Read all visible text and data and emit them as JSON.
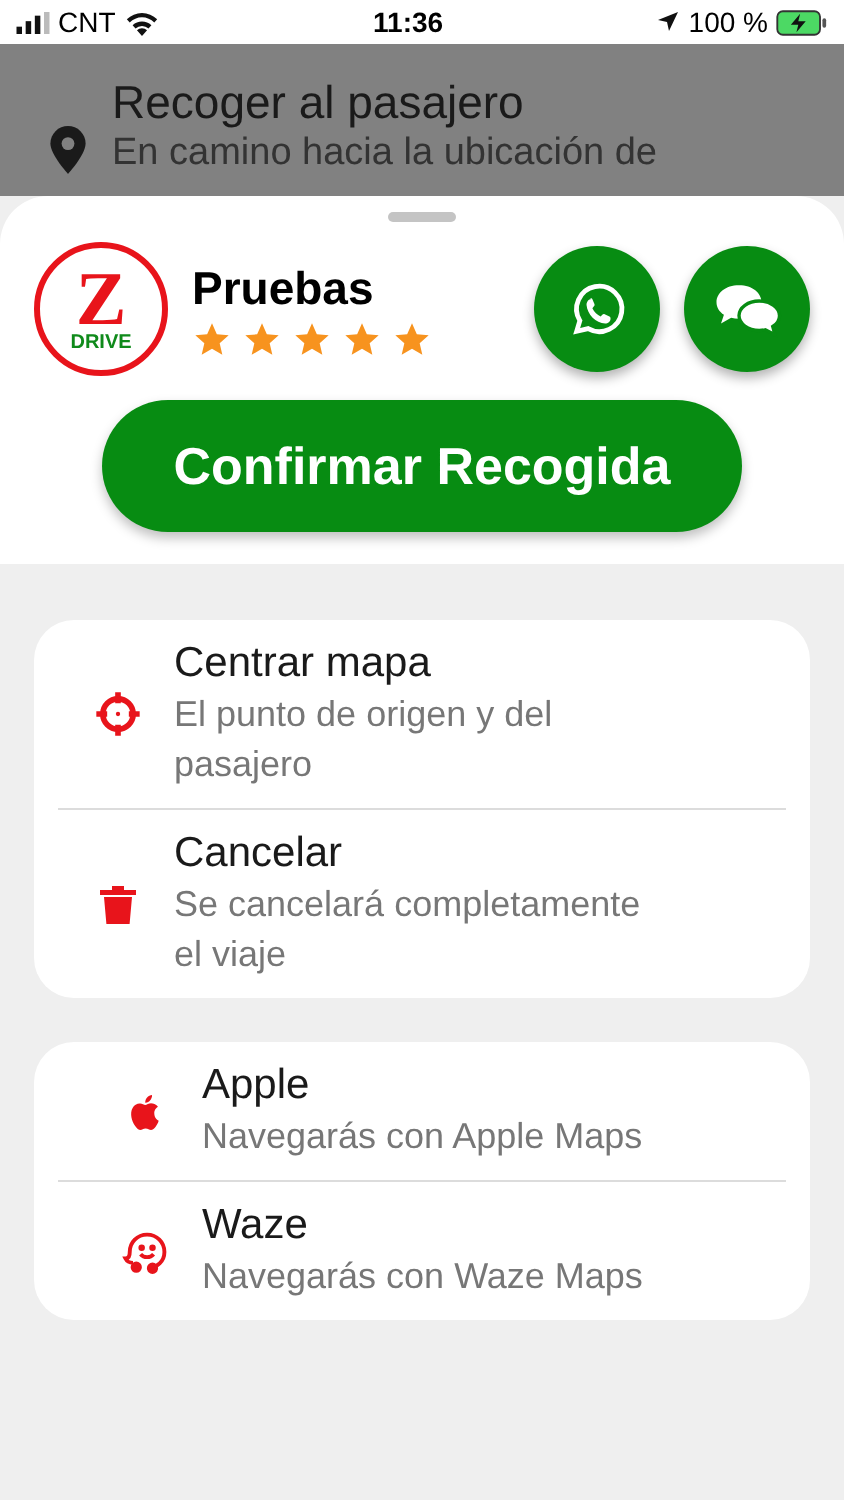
{
  "status_bar": {
    "carrier": "CNT",
    "time": "11:36",
    "battery": "100 %"
  },
  "backdrop": {
    "title": "Recoger al pasajero",
    "subtitle": "En camino hacia la ubicación de"
  },
  "driver": {
    "name": "Pruebas",
    "stars": 5,
    "logo_letter": "Z",
    "logo_word": "DRIVE"
  },
  "confirm_button": "Confirmar Recogida",
  "actions": [
    {
      "kind": "center",
      "title": "Centrar mapa",
      "subtitle": "El punto de origen y del pasajero"
    },
    {
      "kind": "cancel",
      "title": "Cancelar",
      "subtitle": "Se cancelará completamente el viaje"
    }
  ],
  "navigation": [
    {
      "kind": "apple",
      "title": "Apple",
      "subtitle": "Navegarás con Apple Maps"
    },
    {
      "kind": "waze",
      "title": "Waze",
      "subtitle": "Navegarás con Waze Maps"
    }
  ]
}
